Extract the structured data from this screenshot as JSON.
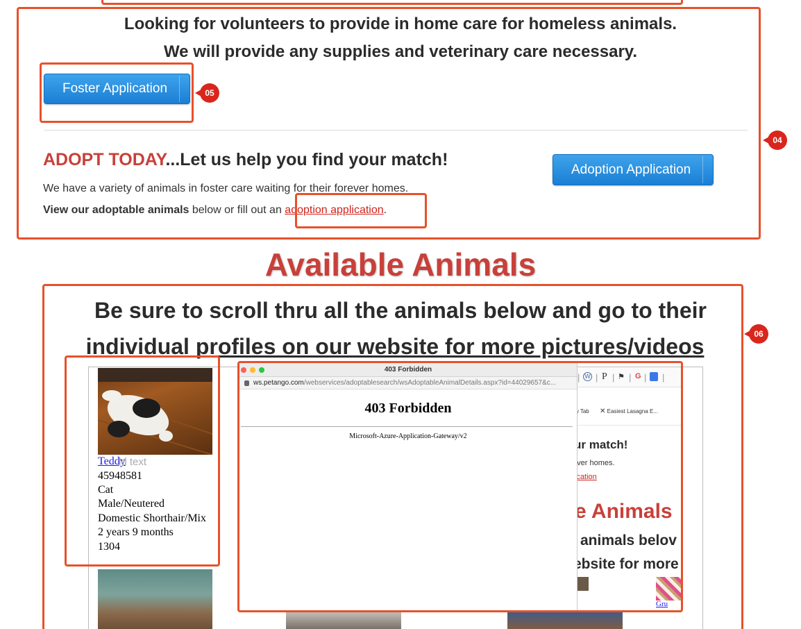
{
  "foster": {
    "line1": "Looking for volunteers to provide in home care for homeless animals.",
    "line2": "We will provide any supplies and veterinary care necessary.",
    "button": "Foster Application"
  },
  "adopt": {
    "headline_red": "ADOPT TODAY",
    "headline_rest": "...Let us help you find your match!",
    "body1": "We have a variety of animals in foster care waiting for their forever homes.",
    "body2_bold": "View our adoptable animals",
    "body2_mid": " below or fill out an ",
    "body2_link": "adoption application",
    "body2_end": ".",
    "button": "Adoption Application"
  },
  "available": {
    "title": "Available Animals",
    "scroll_line1": "Be sure to scroll thru all the animals below and go to their",
    "scroll_line2": "individual profiles on our website for more pictures/videos"
  },
  "animal": {
    "name": "Teddy",
    "add_text": "Add text",
    "id": "45948581",
    "species": "Cat",
    "sex": "Male/Neutered",
    "breed": "Domestic Shorthair/Mix",
    "age": "2 years 9 months",
    "code": "1304"
  },
  "popup": {
    "window_title": "403 Forbidden",
    "url_domain": "ws.petango.com",
    "url_path": "/webservices/adoptablesearch/wsAdoptableAnimalDetails.aspx?id=44029657&c...",
    "heading": "403 Forbidden",
    "server": "Microsoft-Azure-Application-Gateway/v2"
  },
  "background_page": {
    "tab_fragment": "w Tab",
    "bookmark_fragment": "Easiest Lasagna E...",
    "match_fragment": "ur match!",
    "homes_fragment": "ever homes.",
    "link_fragment": "ication",
    "animals_fragment": "e Animals",
    "below_fragment": "animals belov",
    "more_fragment": "ebsite for more",
    "gru_link": "Gru",
    "toolbar_p": "P",
    "toolbar_g": "G"
  },
  "annotations": {
    "tag_04": "04",
    "tag_05": "05",
    "tag_06": "06"
  },
  "colors": {
    "accent_red": "#c8403a",
    "annotation": "#e8502a",
    "button_blue": "#1a7fd4",
    "link": "#1a1aee"
  }
}
